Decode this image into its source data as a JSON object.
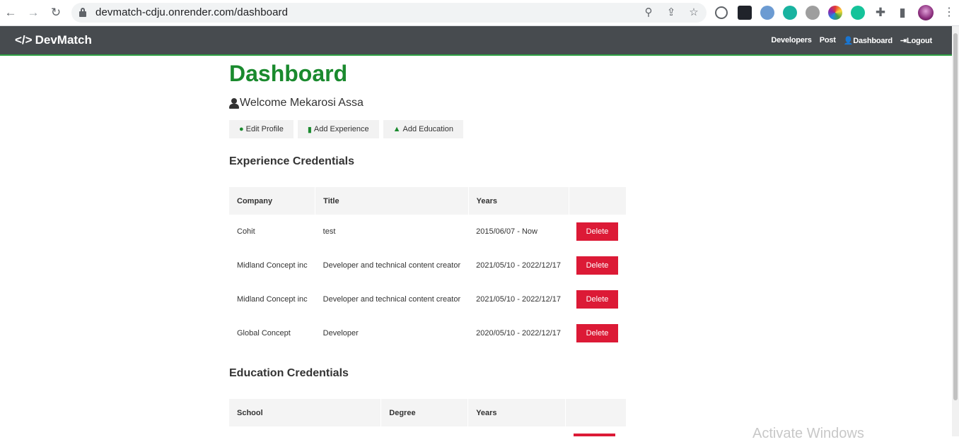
{
  "browser": {
    "url": "devmatch-cdju.onrender.com/dashboard"
  },
  "navbar": {
    "brand": "DevMatch",
    "links": [
      "Developers",
      "Post",
      "Dashboard",
      "Logout"
    ]
  },
  "page": {
    "title": "Dashboard",
    "welcome": "Welcome Mekarosi Assa",
    "actions": [
      "Edit Profile",
      "Add Experience",
      "Add Education"
    ]
  },
  "experience": {
    "heading": "Experience Credentials",
    "columns": [
      "Company",
      "Title",
      "Years",
      ""
    ],
    "rows": [
      {
        "company": "Cohit",
        "title": "test",
        "years": "2015/06/07 - Now",
        "action": "Delete"
      },
      {
        "company": "Midland Concept inc",
        "title": "Developer and technical content creator",
        "years": "2021/05/10 - 2022/12/17",
        "action": "Delete"
      },
      {
        "company": "Midland Concept inc",
        "title": "Developer and technical content creator",
        "years": "2021/05/10 - 2022/12/17",
        "action": "Delete"
      },
      {
        "company": "Global Concept",
        "title": "Developer",
        "years": "2020/05/10 - 2022/12/17",
        "action": "Delete"
      }
    ]
  },
  "education": {
    "heading": "Education Credentials",
    "columns": [
      "School",
      "Degree",
      "Years",
      ""
    ]
  },
  "os": {
    "watermark": "Activate Windows"
  },
  "colors": {
    "accent": "#1a8a2e",
    "navbar": "#474b4f",
    "danger": "#dc1a36"
  }
}
